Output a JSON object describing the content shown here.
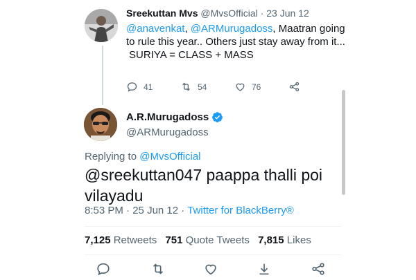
{
  "parent_tweet": {
    "name": "Sreekuttan Mvs",
    "handle": "@MvsOfficial",
    "separator": "·",
    "date": "23 Jun 12",
    "mention1": "@anavenkat",
    "comma": ",",
    "mention2": "@ARMurugadoss",
    "text_rest": ", Maatran going to rule this year.. Others just stay away from it...",
    "text_line2": "SURIYA = CLASS + MASS",
    "replies": "41",
    "retweets": "54",
    "likes": "76"
  },
  "main_tweet": {
    "name": "A.R.Murugadoss",
    "handle": "@ARMurugadoss",
    "replying_prefix": "Replying to",
    "replying_to": "@MvsOfficial",
    "text": "@sreekuttan047 paappa thalli poi vilayadu",
    "time": "8:53 PM",
    "dot": "·",
    "date": "25 Jun 12",
    "dot2": "·",
    "source": "Twitter for BlackBerry®",
    "retweets_count": "7,125",
    "retweets_label": "Retweets",
    "quotes_count": "751",
    "quotes_label": "Quote Tweets",
    "likes_count": "7,815",
    "likes_label": "Likes"
  },
  "colors": {
    "accent": "#1d9bf0",
    "text": "#0f1419",
    "muted": "#536471"
  },
  "icons": [
    "reply-icon",
    "retweet-icon",
    "like-icon",
    "share-icon",
    "verified-badge-icon"
  ]
}
